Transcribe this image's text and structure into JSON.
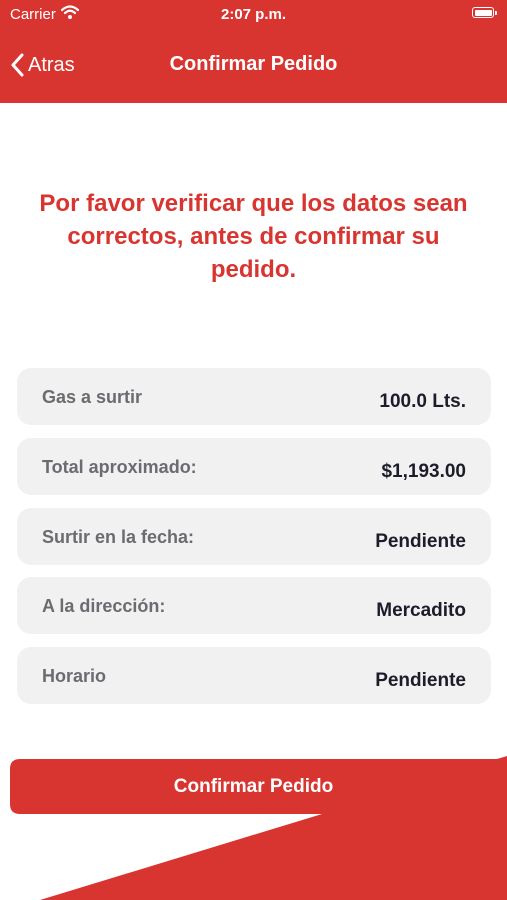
{
  "status_bar": {
    "carrier": "Carrier",
    "time": "2:07 p.m."
  },
  "nav": {
    "back_label": "Atras",
    "title": "Confirmar Pedido"
  },
  "message": "Por favor verificar que los datos sean correctos, antes de confirmar su pedido.",
  "rows": [
    {
      "label": "Gas a surtir",
      "value": "100.0 Lts."
    },
    {
      "label": "Total aproximado:",
      "value": "$1,193.00"
    },
    {
      "label": "Surtir en la fecha:",
      "value": "Pendiente"
    },
    {
      "label": "A la dirección:",
      "value": "Mercadito"
    },
    {
      "label": "Horario",
      "value": "Pendiente"
    }
  ],
  "confirm_button": "Confirmar Pedido",
  "colors": {
    "brand_red": "#d93530",
    "row_background": "#f1f1f2",
    "label_gray": "#6b6b70"
  }
}
